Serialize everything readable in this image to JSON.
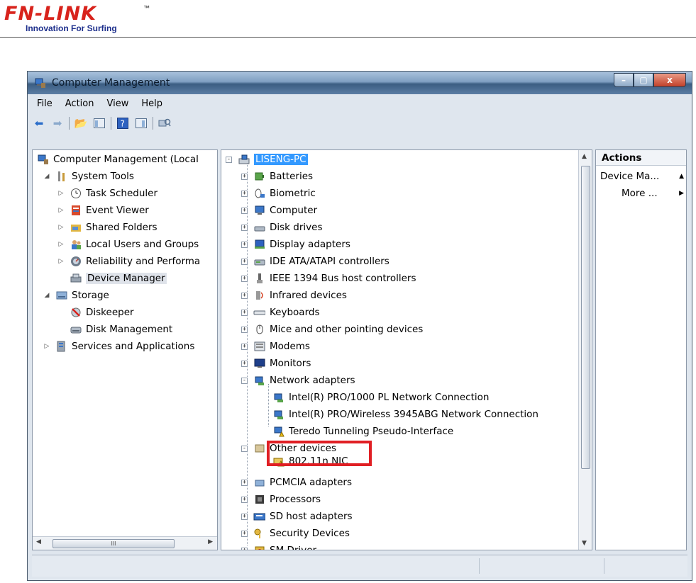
{
  "header": {
    "logo_text": "FN-LINK",
    "trademark": "™",
    "tagline": "Innovation For Surfing"
  },
  "window": {
    "title": "Computer Management",
    "controls": {
      "minimize": "–",
      "maximize": "▢",
      "close": "x"
    }
  },
  "menu": [
    "File",
    "Action",
    "View",
    "Help"
  ],
  "left_tree": [
    {
      "label": "Computer Management (Local",
      "icon": "computer-management-icon"
    },
    {
      "label": "System Tools",
      "icon": "tools-icon"
    },
    {
      "label": "Task Scheduler",
      "icon": "clock-icon"
    },
    {
      "label": "Event Viewer",
      "icon": "event-viewer-icon"
    },
    {
      "label": "Shared Folders",
      "icon": "shared-folder-icon"
    },
    {
      "label": "Local Users and Groups",
      "icon": "users-icon"
    },
    {
      "label": "Reliability and Performa",
      "icon": "performance-icon"
    },
    {
      "label": "Device Manager",
      "icon": "device-manager-icon"
    },
    {
      "label": "Storage",
      "icon": "storage-icon"
    },
    {
      "label": "Diskeeper",
      "icon": "diskeeper-icon"
    },
    {
      "label": "Disk Management",
      "icon": "disk-icon"
    },
    {
      "label": "Services and Applications",
      "icon": "services-icon"
    }
  ],
  "left_scroll_glyph": "III",
  "device_tree": {
    "root": "LISENG-PC",
    "items": [
      "Batteries",
      "Biometric",
      "Computer",
      "Disk drives",
      "Display adapters",
      "IDE ATA/ATAPI controllers",
      "IEEE 1394 Bus host controllers",
      "Infrared devices",
      "Keyboards",
      "Mice and other pointing devices",
      "Modems",
      "Monitors",
      "Network adapters",
      "Intel(R) PRO/1000 PL Network Connection",
      "Intel(R) PRO/Wireless 3945ABG Network Connection",
      "Teredo Tunneling Pseudo-Interface",
      "Other devices",
      "802.11n NIC",
      "PCMCIA adapters",
      "Processors",
      "SD host adapters",
      "Security Devices",
      "SM Driver"
    ]
  },
  "actions": {
    "header": "Actions",
    "items": [
      "Device Ma...",
      "More ..."
    ]
  },
  "colors": {
    "selection": "#3399ff",
    "highlight_box": "#e01f24",
    "logo_red": "#d8231c",
    "tagline_blue": "#1d2f8c"
  }
}
